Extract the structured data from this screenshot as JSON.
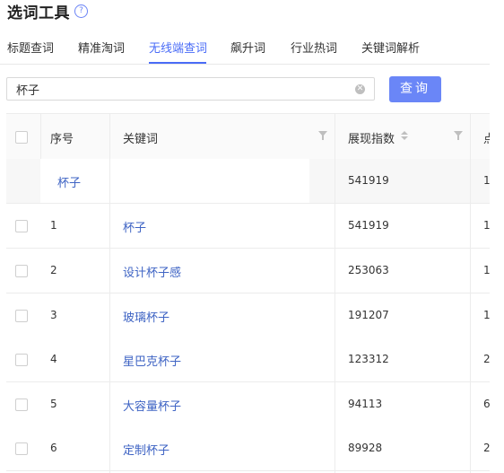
{
  "header": {
    "title": "选词工具",
    "help_icon": "question-circle-icon",
    "help_glyph": "?"
  },
  "tabs": [
    {
      "label": "标题查词",
      "active": false
    },
    {
      "label": "精准淘词",
      "active": false
    },
    {
      "label": "无线端查词",
      "active": true
    },
    {
      "label": "飙升词",
      "active": false
    },
    {
      "label": "行业热词",
      "active": false
    },
    {
      "label": "关键词解析",
      "active": false
    }
  ],
  "search": {
    "value": "杯子",
    "placeholder": "",
    "clear_icon": "clear-circle-icon",
    "clear_glyph": "✕",
    "button_label": "查询"
  },
  "table": {
    "columns": {
      "index": "序号",
      "keyword": "关键词",
      "impressions": "展现指数",
      "next": "点"
    },
    "summary": {
      "keyword": "杯子",
      "impressions": "541919",
      "next": "1"
    },
    "rows": [
      {
        "index": "1",
        "keyword": "杯子",
        "impressions": "541919",
        "next": "1"
      },
      {
        "index": "2",
        "keyword": "设计杯子感",
        "impressions": "253063",
        "next": "1"
      },
      {
        "index": "3",
        "keyword": "玻璃杯子",
        "impressions": "191207",
        "next": "1"
      },
      {
        "index": "4",
        "keyword": "星巴克杯子",
        "impressions": "123312",
        "next": "2"
      },
      {
        "index": "5",
        "keyword": "大容量杯子",
        "impressions": "94113",
        "next": "6"
      },
      {
        "index": "6",
        "keyword": "定制杯子",
        "impressions": "89928",
        "next": "2"
      }
    ]
  },
  "colors": {
    "accent": "#4a6cf7",
    "button": "#6a86f7",
    "link": "#3f64c4"
  }
}
